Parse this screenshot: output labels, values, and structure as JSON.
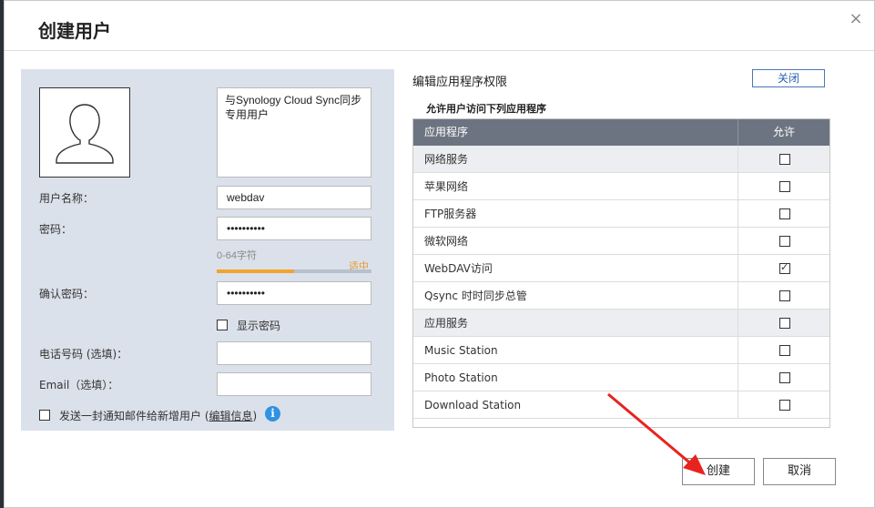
{
  "dialog": {
    "title": "创建用户",
    "close_glyph": "×"
  },
  "user_form": {
    "description": "与Synology Cloud Sync同步专用用户",
    "username_label": "用户名称：",
    "username_value": "webdav",
    "password_label": "密码：",
    "password_value": "••••••••••",
    "password_hint": "0-64字符",
    "strength_label": "适中",
    "strength_fraction": 0.5,
    "confirm_label": "确认密码：",
    "confirm_value": "••••••••••",
    "show_password_label": "显示密码",
    "phone_label": "电话号码 (选填)：",
    "phone_value": "",
    "email_label": "Email（选填）：",
    "email_value": "",
    "notify_prefix": "发送一封通知邮件给新增用户 (",
    "notify_link": "编辑信息",
    "notify_suffix": ")"
  },
  "permissions": {
    "title": "编辑应用程序权限",
    "close_label": "关闭",
    "subtitle": "允许用户访问下列应用程序",
    "col_app": "应用程序",
    "col_allow": "允许",
    "rows": [
      {
        "label": "网络服务",
        "group": true,
        "checked": false
      },
      {
        "label": "苹果网络",
        "group": false,
        "checked": false
      },
      {
        "label": "FTP服务器",
        "group": false,
        "checked": false
      },
      {
        "label": "微软网络",
        "group": false,
        "checked": false
      },
      {
        "label": "WebDAV访问",
        "group": false,
        "checked": true
      },
      {
        "label": "Qsync 时时同步总管",
        "group": false,
        "checked": false
      },
      {
        "label": "应用服务",
        "group": true,
        "checked": false
      },
      {
        "label": "Music Station",
        "group": false,
        "checked": false
      },
      {
        "label": "Photo Station",
        "group": false,
        "checked": false
      },
      {
        "label": "Download Station",
        "group": false,
        "checked": false
      }
    ]
  },
  "buttons": {
    "create": "创建",
    "cancel": "取消"
  },
  "colors": {
    "accent": "#2f93e0",
    "strength": "#f2a42c",
    "arrow": "#e8231f"
  }
}
